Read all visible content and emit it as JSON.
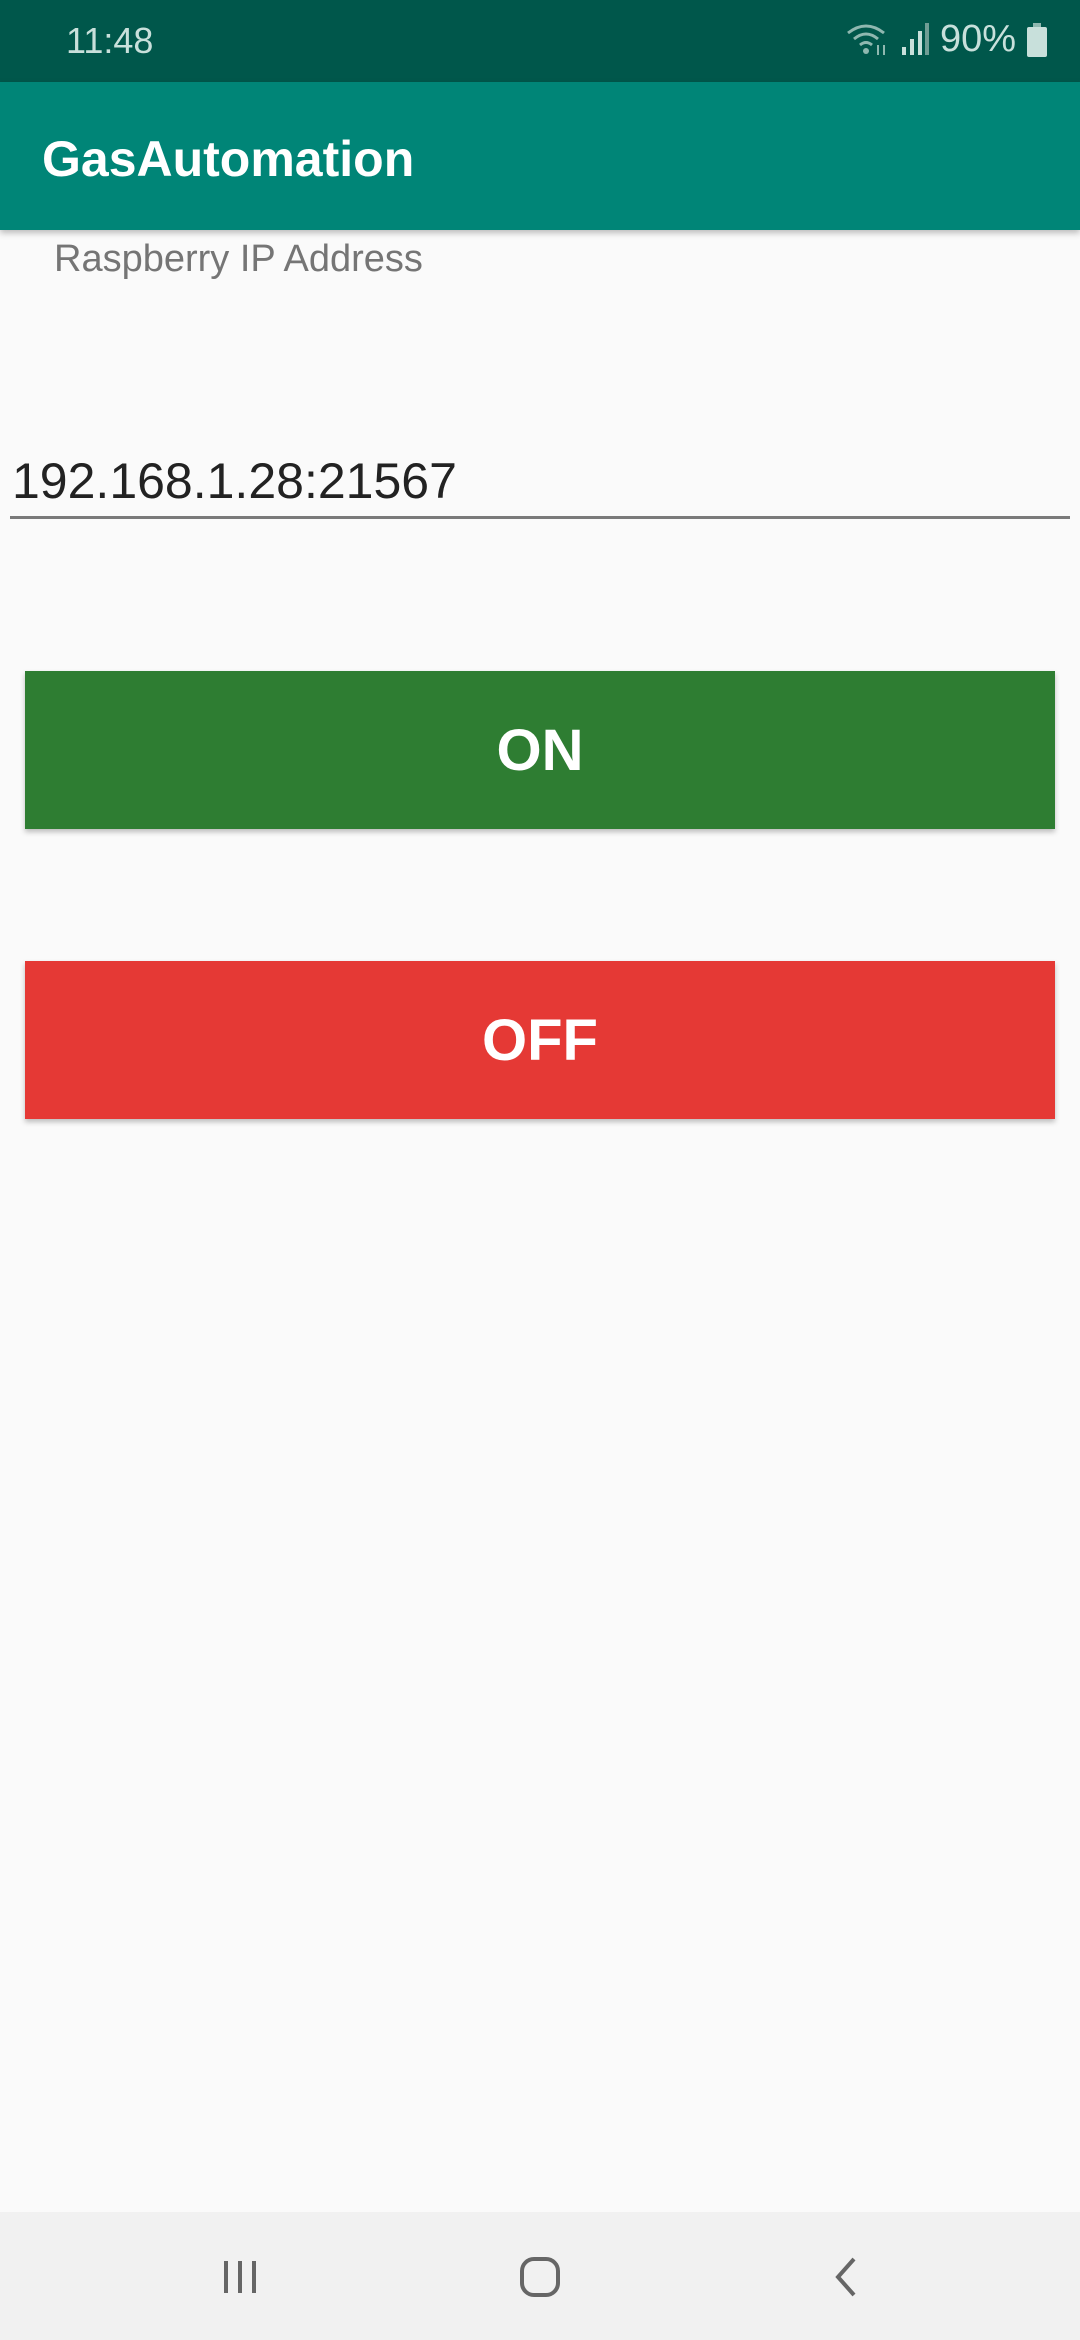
{
  "status_bar": {
    "time": "11:48",
    "battery": "90%",
    "icons": [
      "wifi-icon",
      "signal-icon",
      "battery-icon"
    ]
  },
  "app_bar": {
    "title": "GasAutomation"
  },
  "form": {
    "label": "Raspberry IP Address",
    "ip_value": "192.168.1.28:21567"
  },
  "buttons": {
    "on": "ON",
    "off": "OFF",
    "on_color": "#2e7d32",
    "off_color": "#e53935"
  },
  "nav": {
    "icons": [
      "recent-apps-icon",
      "home-icon",
      "back-icon"
    ]
  }
}
